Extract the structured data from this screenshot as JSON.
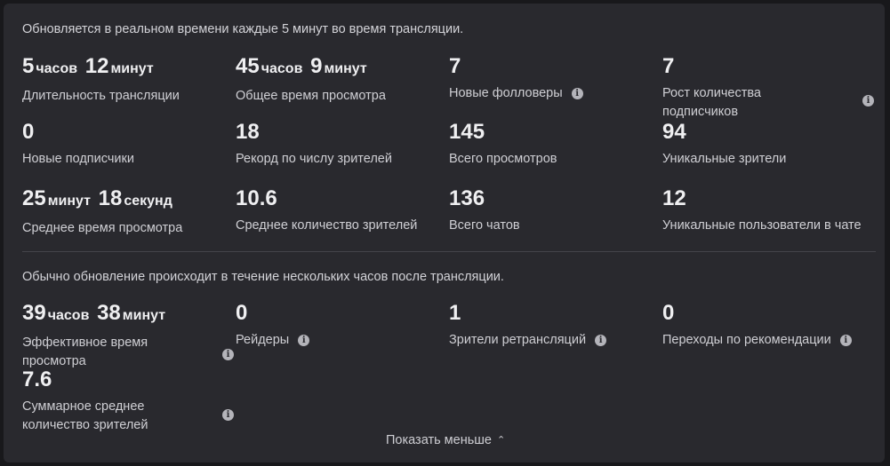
{
  "realtime": {
    "note": "Обновляется в реальном времени каждые 5 минут во время трансляции.",
    "stats": [
      {
        "parts": [
          {
            "n": "5",
            "u": "часов"
          },
          {
            "n": "12",
            "u": "минут"
          }
        ],
        "label": "Длительность трансляции"
      },
      {
        "parts": [
          {
            "n": "45",
            "u": "часов"
          },
          {
            "n": "9",
            "u": "минут"
          }
        ],
        "label": "Общее время просмотра"
      },
      {
        "value": "7",
        "label": "Новые фолловеры",
        "info": true
      },
      {
        "value": "7",
        "label": "Рост количества подписчиков",
        "info": true
      },
      {
        "value": "0",
        "label": "Новые подписчики"
      },
      {
        "value": "18",
        "label": "Рекорд по числу зрителей"
      },
      {
        "value": "145",
        "label": "Всего просмотров"
      },
      {
        "value": "94",
        "label": "Уникальные зрители"
      },
      {
        "parts": [
          {
            "n": "25",
            "u": "минут"
          },
          {
            "n": "18",
            "u": "секунд"
          }
        ],
        "label": "Среднее время просмотра"
      },
      {
        "value": "10.6",
        "label": "Среднее количество зрителей"
      },
      {
        "value": "136",
        "label": "Всего чатов"
      },
      {
        "value": "12",
        "label": "Уникальные пользователи в чате"
      }
    ]
  },
  "delayed": {
    "note": "Обычно обновление происходит в течение нескольких часов после трансляции.",
    "stats": [
      {
        "parts": [
          {
            "n": "39",
            "u": "часов"
          },
          {
            "n": "38",
            "u": "минут"
          }
        ],
        "label": "Эффективное время просмотра",
        "info": true
      },
      {
        "value": "0",
        "label": "Рейдеры",
        "info": true
      },
      {
        "value": "1",
        "label": "Зрители ретрансляций",
        "info": true
      },
      {
        "value": "0",
        "label": "Переходы по рекомендации",
        "info": true
      },
      {
        "value": "7.6",
        "label": "Суммарное среднее количество зрителей",
        "info": true
      }
    ]
  },
  "icons": {
    "info": "info-icon",
    "chevron": "chevron-up-icon"
  },
  "show_less": "Показать меньше"
}
